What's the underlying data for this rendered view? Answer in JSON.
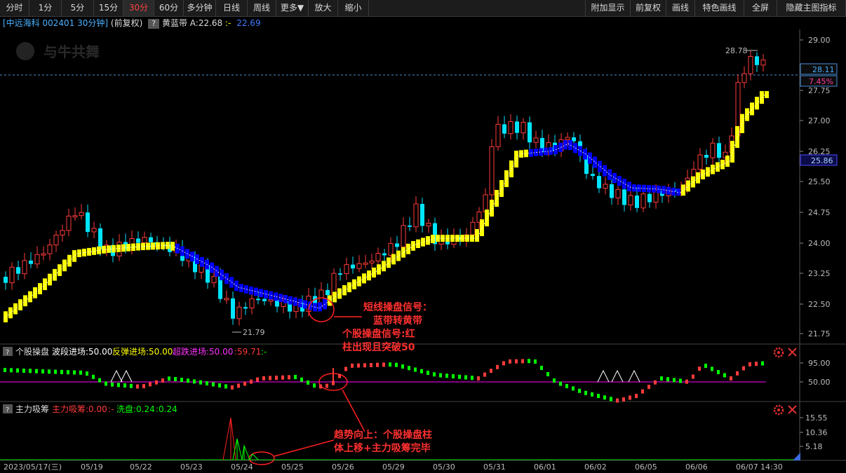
{
  "toolbar": {
    "left": [
      "分时",
      "1分",
      "5分",
      "15分",
      "30分",
      "60分",
      "多分钟",
      "日线",
      "周线",
      "更多▼",
      "放大",
      "缩小"
    ],
    "active": "30分",
    "right": [
      "附加显示",
      "前复权",
      "画线",
      "特色画线",
      "全屏",
      "隐藏主图指标"
    ]
  },
  "header": {
    "stock": "[中远海科 002401 30分钟]",
    "adjust": "(前复权)",
    "q": "?",
    "indicator": "黄蓝带",
    "a_value": "A:22.68",
    "sep": ":-",
    "b_value": "22.69"
  },
  "watermark": "与牛共舞",
  "main_axis": {
    "labels": [
      "29.00",
      "28.25",
      "27.75",
      "27.00",
      "26.25",
      "25.50",
      "24.75",
      "24.00",
      "23.25",
      "22.50",
      "21.75"
    ]
  },
  "price_tags": {
    "current": "28.11",
    "pct": "7.45%",
    "level": "25.86"
  },
  "markers": {
    "high": "28.78",
    "low": "21.79"
  },
  "annotations": {
    "a1_line1": "短线操盘信号：",
    "a1_line2": "蓝带转黄带",
    "a2_line1": "个股操盘信号:红",
    "a2_line2": "柱出现且突破50",
    "a3_line1": "趋势向上：个股操盘柱",
    "a3_line2": "体上移+主力吸筹完毕"
  },
  "panel1": {
    "q": "?",
    "name": "个股操盘",
    "l1": "波段进场:50.00",
    "l2": "反弹进场:50.00",
    "l3": "超跌进场:50.00",
    "l4": ":59.71",
    "l5": ":-",
    "axis": [
      "95.00",
      "50.00"
    ]
  },
  "panel2": {
    "q": "?",
    "name": "主力吸筹",
    "l1": "主力吸筹:0.00",
    "l2": ":-",
    "l3": "洗盘:0.24",
    "l4": ":0.24",
    "axis": [
      "15.55",
      "10.36",
      "5.18"
    ]
  },
  "dates": [
    "2023/05/17(三)",
    "05/19",
    "05/22",
    "05/23",
    "05/24",
    "05/25",
    "05/26",
    "05/29",
    "05/30",
    "05/31",
    "06/01",
    "06/02",
    "06/05",
    "06/06",
    "06/07",
    "14:30"
  ],
  "colors": {
    "up": "#ff3b3b",
    "down": "#00e5ff",
    "yellow": "#ffff00",
    "blue": "#0000ff",
    "magenta": "#ff00ff",
    "green": "#00ff00",
    "axis": "#8a8a8a"
  }
}
